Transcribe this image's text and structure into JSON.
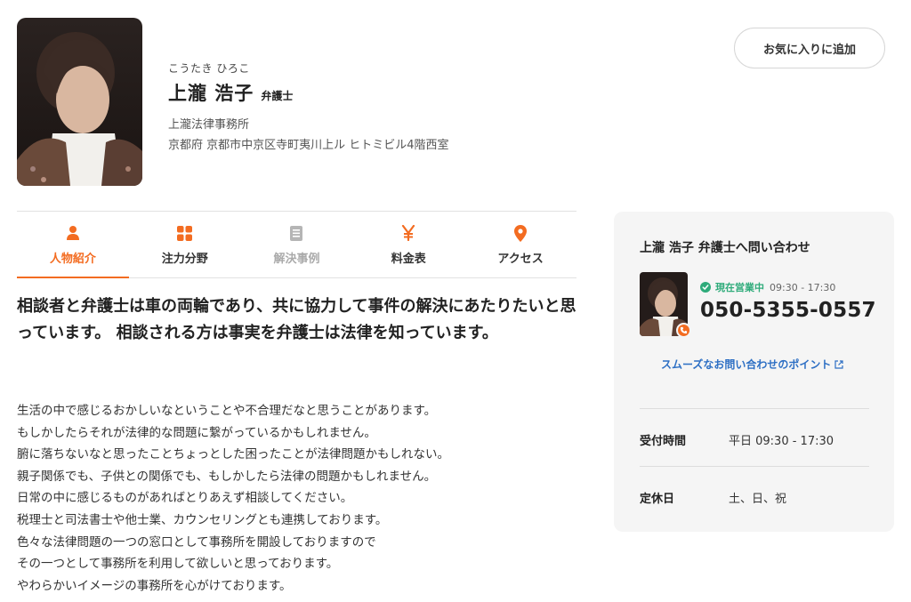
{
  "lawyer": {
    "kana": "こうたき ひろこ",
    "name": "上瀧 浩子",
    "title": "弁護士",
    "office": "上瀧法律事務所",
    "address": "京都府 京都市中京区寺町夷川上ル ヒトミビル4階西室"
  },
  "favorite_button": "お気に入りに追加",
  "tabs": [
    {
      "label": "人物紹介",
      "icon": "person-icon",
      "active": true
    },
    {
      "label": "注力分野",
      "icon": "grid-icon",
      "active": false
    },
    {
      "label": "解決事例",
      "icon": "document-icon",
      "active": false,
      "disabled": true
    },
    {
      "label": "料金表",
      "icon": "yen-icon",
      "active": false
    },
    {
      "label": "アクセス",
      "icon": "location-pin-icon",
      "active": false
    }
  ],
  "headline": "相談者と弁護士は車の両輪であり、共に協力して事件の解決にあたりたいと思っています。 相談される方は事実を弁護士は法律を知っています。",
  "body_lines": [
    "生活の中で感じるおかしいなということや不合理だなと思うことがあります。",
    "もしかしたらそれが法律的な問題に繋がっているかもしれません。",
    "腑に落ちないなと思ったことちょっとした困ったことが法律問題かもしれない。",
    "親子関係でも、子供との関係でも、もしかしたら法律の問題かもしれません。",
    "日常の中に感じるものがあればとりあえず相談してください。",
    "税理士と司法書士や他士業、カウンセリングとも連携しております。",
    "色々な法律問題の一つの窓口として事務所を開設しておりますので",
    "その一つとして事務所を利用して欲しいと思っております。",
    "やわらかいイメージの事務所を心がけております。"
  ],
  "contact": {
    "title": "上瀧 浩子 弁護士へ問い合わせ",
    "status_label": "現在営業中",
    "status_hours": "09:30 - 17:30",
    "phone": "050-5355-0557",
    "tips_link": "スムーズなお問い合わせのポイント",
    "reception_label": "受付時間",
    "reception_value": "平日 09:30 - 17:30",
    "closed_label": "定休日",
    "closed_value": "土、日、祝"
  },
  "colors": {
    "accent": "#f36c21",
    "open_status": "#2eab7a",
    "link": "#2d6fc4",
    "card_bg": "#f5f5f5"
  }
}
